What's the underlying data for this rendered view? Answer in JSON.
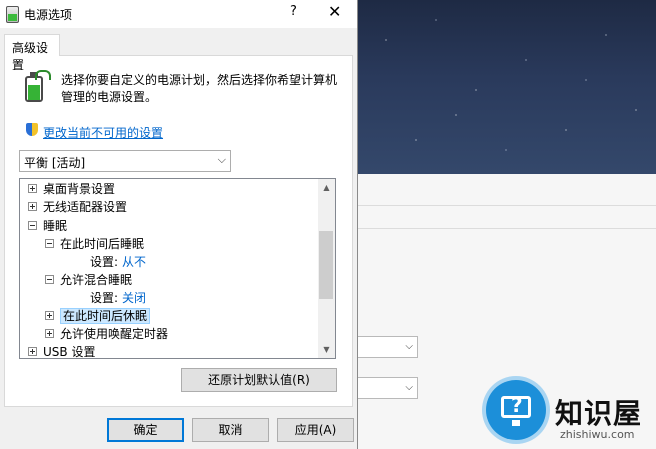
{
  "window": {
    "title": "电源选项",
    "help_glyph": "?",
    "close_glyph": "✕"
  },
  "tab": {
    "label": "高级设置"
  },
  "intro": {
    "text": "选择你要自定义的电源计划，然后选择你希望计算机管理的电源设置。"
  },
  "link": {
    "label": "更改当前不可用的设置"
  },
  "plan_select": {
    "value": "平衡 [活动]"
  },
  "tree": {
    "items": [
      {
        "label": "桌面背景设置",
        "toggle": "+"
      },
      {
        "label": "无线适配器设置",
        "toggle": "+"
      },
      {
        "label": "睡眠",
        "toggle": "-"
      },
      {
        "label": "在此时间后睡眠",
        "toggle": "-"
      },
      {
        "label": "设置:",
        "value": "从不"
      },
      {
        "label": "允许混合睡眠",
        "toggle": "-"
      },
      {
        "label": "设置:",
        "value": "关闭"
      },
      {
        "label": "在此时间后休眠",
        "toggle": "+",
        "selected": true
      },
      {
        "label": "允许使用唤醒定时器",
        "toggle": "+"
      },
      {
        "label": "USB 设置",
        "toggle": "+"
      }
    ]
  },
  "buttons": {
    "restore": "还原计划默认值(R)",
    "ok": "确定",
    "cancel": "取消",
    "apply": "应用(A)"
  },
  "watermark": {
    "title": "知识屋",
    "url": "zhishiwu.com"
  },
  "colors": {
    "link": "#0066cc",
    "selection": "#cce8ff",
    "primary_border": "#0078d7"
  }
}
